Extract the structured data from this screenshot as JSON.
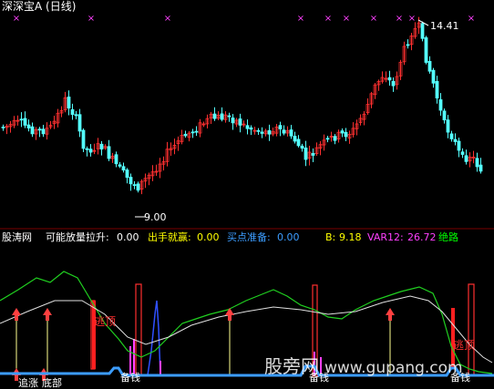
{
  "title": "深深宝A (日线)",
  "main_chart": {
    "high_label": "14.41",
    "low_label": "9.00",
    "colors": {
      "up": "#ff3030",
      "down": "#54ffff",
      "marker": "#ff40ff"
    }
  },
  "indicator": {
    "name": "股涛网",
    "fields": [
      {
        "label": "可能放量拉升:",
        "value": "0.00",
        "color": "#ffffff"
      },
      {
        "label": "出手就赢:",
        "value": "0.00",
        "color": "#ffff00"
      },
      {
        "label": "买点准备:",
        "value": "0.00",
        "color": "#3c9dff"
      },
      {
        "label": "B:",
        "value": "9.18",
        "color": "#ffff00"
      },
      {
        "label": "VAR12:",
        "value": "26.72",
        "color": "#ff40ff"
      },
      {
        "label": "绝路",
        "value": "",
        "color": "#00ff00"
      }
    ],
    "signals": {
      "escape": "逃顶",
      "ready": "备钱",
      "chase": "追涨",
      "bottom": "底部"
    }
  },
  "watermark": {
    "cn": "股旁网",
    "url": "www.gupang.com"
  }
}
